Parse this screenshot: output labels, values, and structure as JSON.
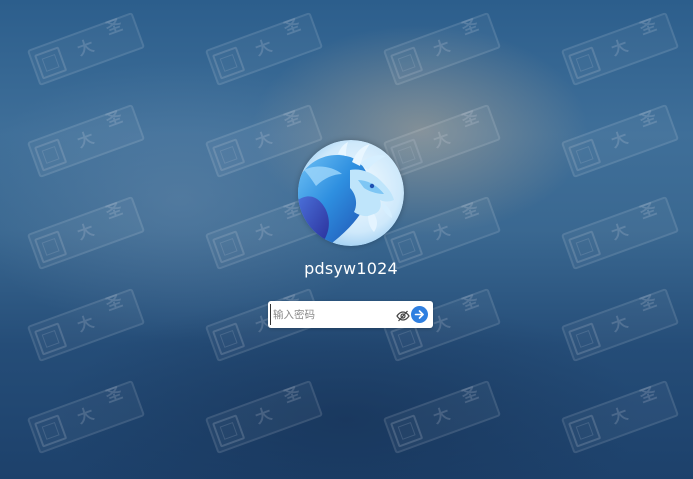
{
  "login": {
    "username": "pdsyw1024",
    "password_placeholder": "输入密码"
  },
  "watermark": {
    "text_chars": [
      "大",
      "圣"
    ]
  },
  "icons": {
    "avatar": "dragon-avatar-icon",
    "show_password": "eye-slash-icon",
    "submit": "arrow-right-icon"
  },
  "colors": {
    "submit_button": "#2f7fe0",
    "username_text": "#ffffff",
    "input_background": "#ffffff"
  }
}
